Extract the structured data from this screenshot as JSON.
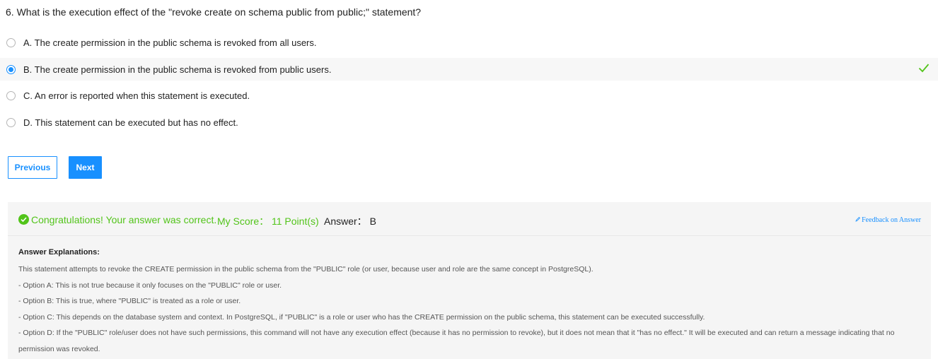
{
  "question": {
    "text": "6. What is the execution effect of the \"revoke create on schema public from public;\" statement?"
  },
  "options": [
    {
      "label": "A. The create permission in the public schema is revoked from all users.",
      "selected": false
    },
    {
      "label": "B. The create permission in the public schema is revoked from public users.",
      "selected": true,
      "correct": true
    },
    {
      "label": "C. An error is reported when this statement is executed.",
      "selected": false
    },
    {
      "label": "D. This statement can be executed but has no effect.",
      "selected": false
    }
  ],
  "nav": {
    "previous_label": "Previous",
    "next_label": "Next"
  },
  "result": {
    "congrats": "Congratulations! Your answer was correct.",
    "score": "My Score： 11 Point(s)",
    "answer": "Answer： B",
    "feedback_label": "Feedback on Answer"
  },
  "explanation": {
    "title": "Answer Explanations:",
    "lines": [
      "This statement attempts to revoke the CREATE permission in the public schema from the \"PUBLIC\" role (or user, because user and role are the same concept in PostgreSQL).",
      "- Option A: This is not true because it only focuses on the \"PUBLIC\" role or user.",
      "- Option B: This is true, where \"PUBLIC\" is treated as a role or user.",
      "- Option C: This depends on the database system and context. In PostgreSQL, if \"PUBLIC\" is a role or user who has the CREATE permission on the public schema, this statement can be executed successfully.",
      "- Option D: If the \"PUBLIC\" role/user does not have such permissions, this command will not have any execution effect (because it has no permission to revoke), but it does not mean that it \"has no effect.\" It will be executed and can return a message indicating that no permission was revoked."
    ]
  },
  "colors": {
    "accent": "#1890ff",
    "success": "#52c41a",
    "panel_bg": "#f5f5f5"
  },
  "icons": {
    "check": "check-icon",
    "success": "check-circle-icon",
    "feedback": "pencil-icon"
  }
}
